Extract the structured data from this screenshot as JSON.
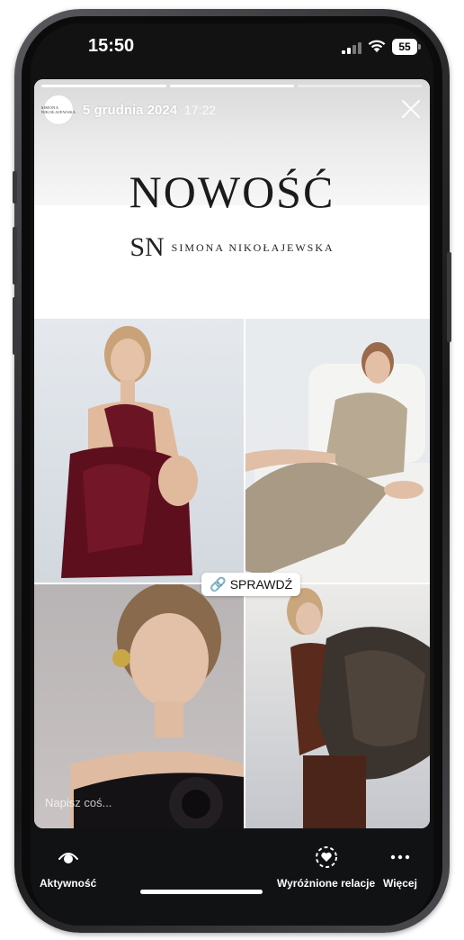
{
  "status_bar": {
    "time": "15:50",
    "battery": "55"
  },
  "story": {
    "avatar_text": "SIMONA NIKOŁAJEWSKA",
    "date": "5 grudnia 2024",
    "time": "17:22",
    "headline": "NOWOŚĆ",
    "brand_logo": "SN",
    "brand_name": "SIMONA NIKOŁAJEWSKA",
    "link_sticker": "SPRAWDŹ",
    "reply_placeholder": "Napisz coś..."
  },
  "bottom_bar": {
    "activity_label": "Aktywność",
    "highlights_label": "Wyróżnione relacje",
    "more_label": "Więcej"
  },
  "colors": {
    "accent": "#ffffff",
    "background": "#111214"
  }
}
